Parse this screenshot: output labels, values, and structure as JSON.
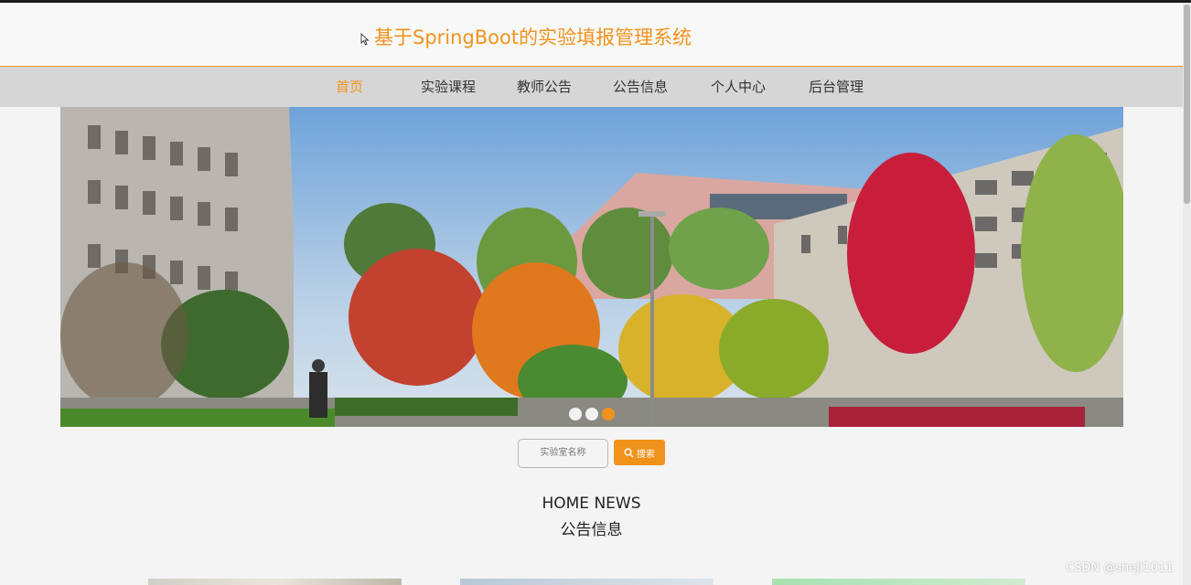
{
  "header": {
    "title": "基于SpringBoot的实验填报管理系统",
    "title_color": "#f0931d"
  },
  "nav": {
    "items": [
      {
        "label": "首页",
        "active": true
      },
      {
        "label": "实验课程",
        "active": false
      },
      {
        "label": "教师公告",
        "active": false
      },
      {
        "label": "公告信息",
        "active": false
      },
      {
        "label": "个人中心",
        "active": false
      },
      {
        "label": "后台管理",
        "active": false
      }
    ],
    "accent": "#f0931d",
    "background": "#d6d6d6"
  },
  "banner": {
    "image": "campus-autumn-photo",
    "slides": 3,
    "active_slide": 3
  },
  "search": {
    "placeholder": "实验室名称",
    "button_label": "搜索",
    "button_icon": "search-icon"
  },
  "news_section": {
    "title_en": "HOME NEWS",
    "title_cn": "公告信息"
  },
  "watermark": "CSDN @sheji1011"
}
